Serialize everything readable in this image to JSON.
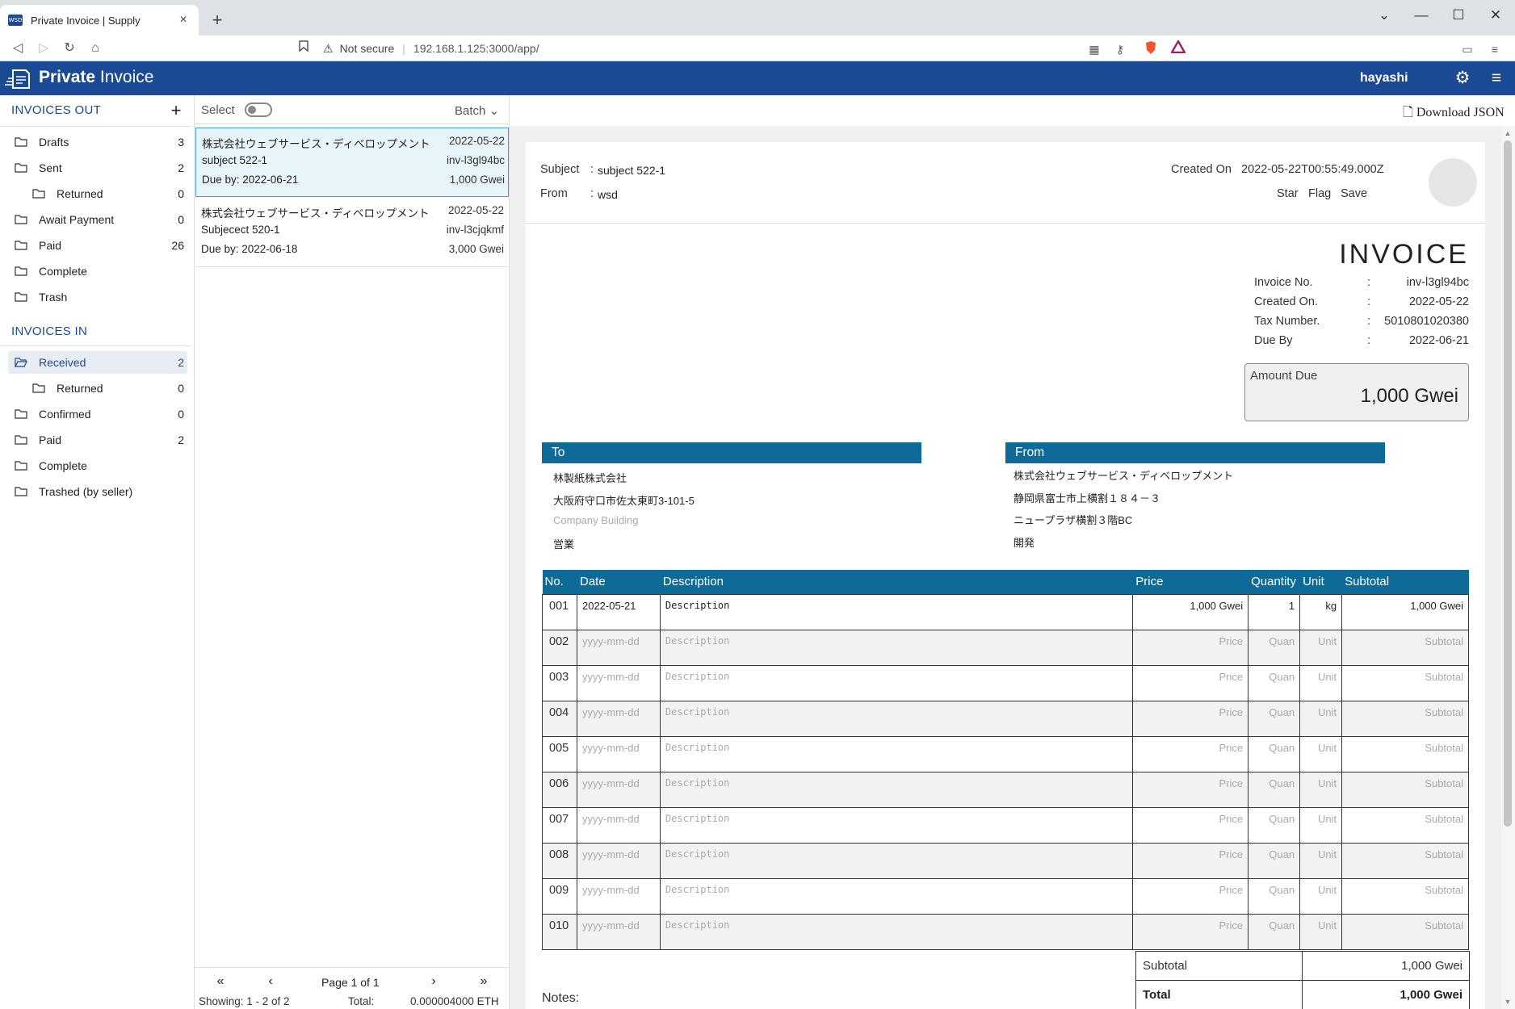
{
  "browser": {
    "tab_title": "Private Invoice | Supply",
    "favicon_text": "WSD",
    "new_tab": "+",
    "close_tab": "×",
    "not_secure": "Not secure",
    "url": "192.168.1.125:3000/app/"
  },
  "app": {
    "brand_bold": "Private",
    "brand_rest": " Invoice",
    "username": "hayashi"
  },
  "sidebar": {
    "out_title": "INVOICES OUT",
    "out_items": [
      {
        "label": "Drafts",
        "count": "3"
      },
      {
        "label": "Sent",
        "count": "2"
      },
      {
        "label": "Returned",
        "count": "0"
      },
      {
        "label": "Await Payment",
        "count": "0"
      },
      {
        "label": "Paid",
        "count": "26"
      },
      {
        "label": "Complete",
        "count": ""
      },
      {
        "label": "Trash",
        "count": ""
      }
    ],
    "in_title": "INVOICES IN",
    "in_items": [
      {
        "label": "Received",
        "count": "2"
      },
      {
        "label": "Returned",
        "count": "0"
      },
      {
        "label": "Confirmed",
        "count": "0"
      },
      {
        "label": "Paid",
        "count": "2"
      },
      {
        "label": "Complete",
        "count": ""
      },
      {
        "label": "Trashed (by seller)",
        "count": ""
      }
    ]
  },
  "list": {
    "select_label": "Select",
    "batch_label": "Batch",
    "items": [
      {
        "seller": "株式会社ウェブサービス・ディベロップメント",
        "date": "2022-05-22",
        "subject": "subject 522-1",
        "invoice_no": "inv-l3gl94bc",
        "due": "Due by: 2022-06-21",
        "amount": "1,000 Gwei"
      },
      {
        "seller": "株式会社ウェブサービス・ディベロップメント",
        "date": "2022-05-22",
        "subject": "Subjecect 520-1",
        "invoice_no": "inv-l3cjqkmf",
        "due": "Due by: 2022-06-18",
        "amount": "3,000 Gwei"
      }
    ],
    "pager": {
      "page_text": "Page 1 of 1",
      "showing": "Showing: 1 - 2 of 2",
      "total_label": "Total:",
      "total_value": "0.000004000 ETH"
    }
  },
  "detail": {
    "download_json": "Download JSON",
    "subject_label": "Subject",
    "subject_value": "subject 522-1",
    "from_label": "From",
    "from_value": "wsd",
    "colon": ":",
    "created_on_label": "Created On",
    "created_on_value": "2022-05-22T00:55:49.000Z",
    "actions": {
      "star": "Star",
      "flag": "Flag",
      "save": "Save"
    },
    "invoice_title": "INVOICE",
    "meta": [
      {
        "label": "Invoice No.",
        "value": "inv-l3gl94bc"
      },
      {
        "label": "Created On.",
        "value": "2022-05-22"
      },
      {
        "label": "Tax Number.",
        "value": "5010801020380"
      },
      {
        "label": "Due By",
        "value": "2022-06-21"
      }
    ],
    "amount_due_label": "Amount Due",
    "amount_due_value": "1,000 Gwei",
    "to": {
      "title": "To",
      "lines": [
        "林製紙株式会社",
        "大阪府守口市佐太東町3-101-5",
        "Company Building",
        "営業"
      ]
    },
    "from": {
      "title": "From",
      "lines": [
        "株式会社ウェブサービス・ディベロップメント",
        "静岡県富士市上横割１８４－３",
        "ニュープラザ横割３階BC",
        "開発"
      ]
    },
    "table": {
      "headers": [
        "No.",
        "Date",
        "Description",
        "Price",
        "Quantity",
        "Unit",
        "Subtotal"
      ],
      "rows": [
        {
          "no": "001",
          "date": "2022-05-21",
          "desc": "Description",
          "price": "1,000 Gwei",
          "qty": "1",
          "unit": "kg",
          "subtotal": "1,000 Gwei",
          "filled": true
        },
        {
          "no": "002",
          "date": "yyyy-mm-dd",
          "desc": "Description",
          "price": "Price",
          "qty": "Quan",
          "unit": "Unit",
          "subtotal": "Subtotal",
          "filled": false
        },
        {
          "no": "003",
          "date": "yyyy-mm-dd",
          "desc": "Description",
          "price": "Price",
          "qty": "Quan",
          "unit": "Unit",
          "subtotal": "Subtotal",
          "filled": false
        },
        {
          "no": "004",
          "date": "yyyy-mm-dd",
          "desc": "Description",
          "price": "Price",
          "qty": "Quan",
          "unit": "Unit",
          "subtotal": "Subtotal",
          "filled": false
        },
        {
          "no": "005",
          "date": "yyyy-mm-dd",
          "desc": "Description",
          "price": "Price",
          "qty": "Quan",
          "unit": "Unit",
          "subtotal": "Subtotal",
          "filled": false
        },
        {
          "no": "006",
          "date": "yyyy-mm-dd",
          "desc": "Description",
          "price": "Price",
          "qty": "Quan",
          "unit": "Unit",
          "subtotal": "Subtotal",
          "filled": false
        },
        {
          "no": "007",
          "date": "yyyy-mm-dd",
          "desc": "Description",
          "price": "Price",
          "qty": "Quan",
          "unit": "Unit",
          "subtotal": "Subtotal",
          "filled": false
        },
        {
          "no": "008",
          "date": "yyyy-mm-dd",
          "desc": "Description",
          "price": "Price",
          "qty": "Quan",
          "unit": "Unit",
          "subtotal": "Subtotal",
          "filled": false
        },
        {
          "no": "009",
          "date": "yyyy-mm-dd",
          "desc": "Description",
          "price": "Price",
          "qty": "Quan",
          "unit": "Unit",
          "subtotal": "Subtotal",
          "filled": false
        },
        {
          "no": "010",
          "date": "yyyy-mm-dd",
          "desc": "Description",
          "price": "Price",
          "qty": "Quan",
          "unit": "Unit",
          "subtotal": "Subtotal",
          "filled": false
        }
      ]
    },
    "subtotal_label": "Subtotal",
    "subtotal_value": "1,000 Gwei",
    "total_label": "Total",
    "total_value": "1,000 Gwei",
    "notes_label": "Notes:"
  },
  "colors": {
    "brand": "#1a4a94",
    "table_header": "#0e6a96"
  }
}
